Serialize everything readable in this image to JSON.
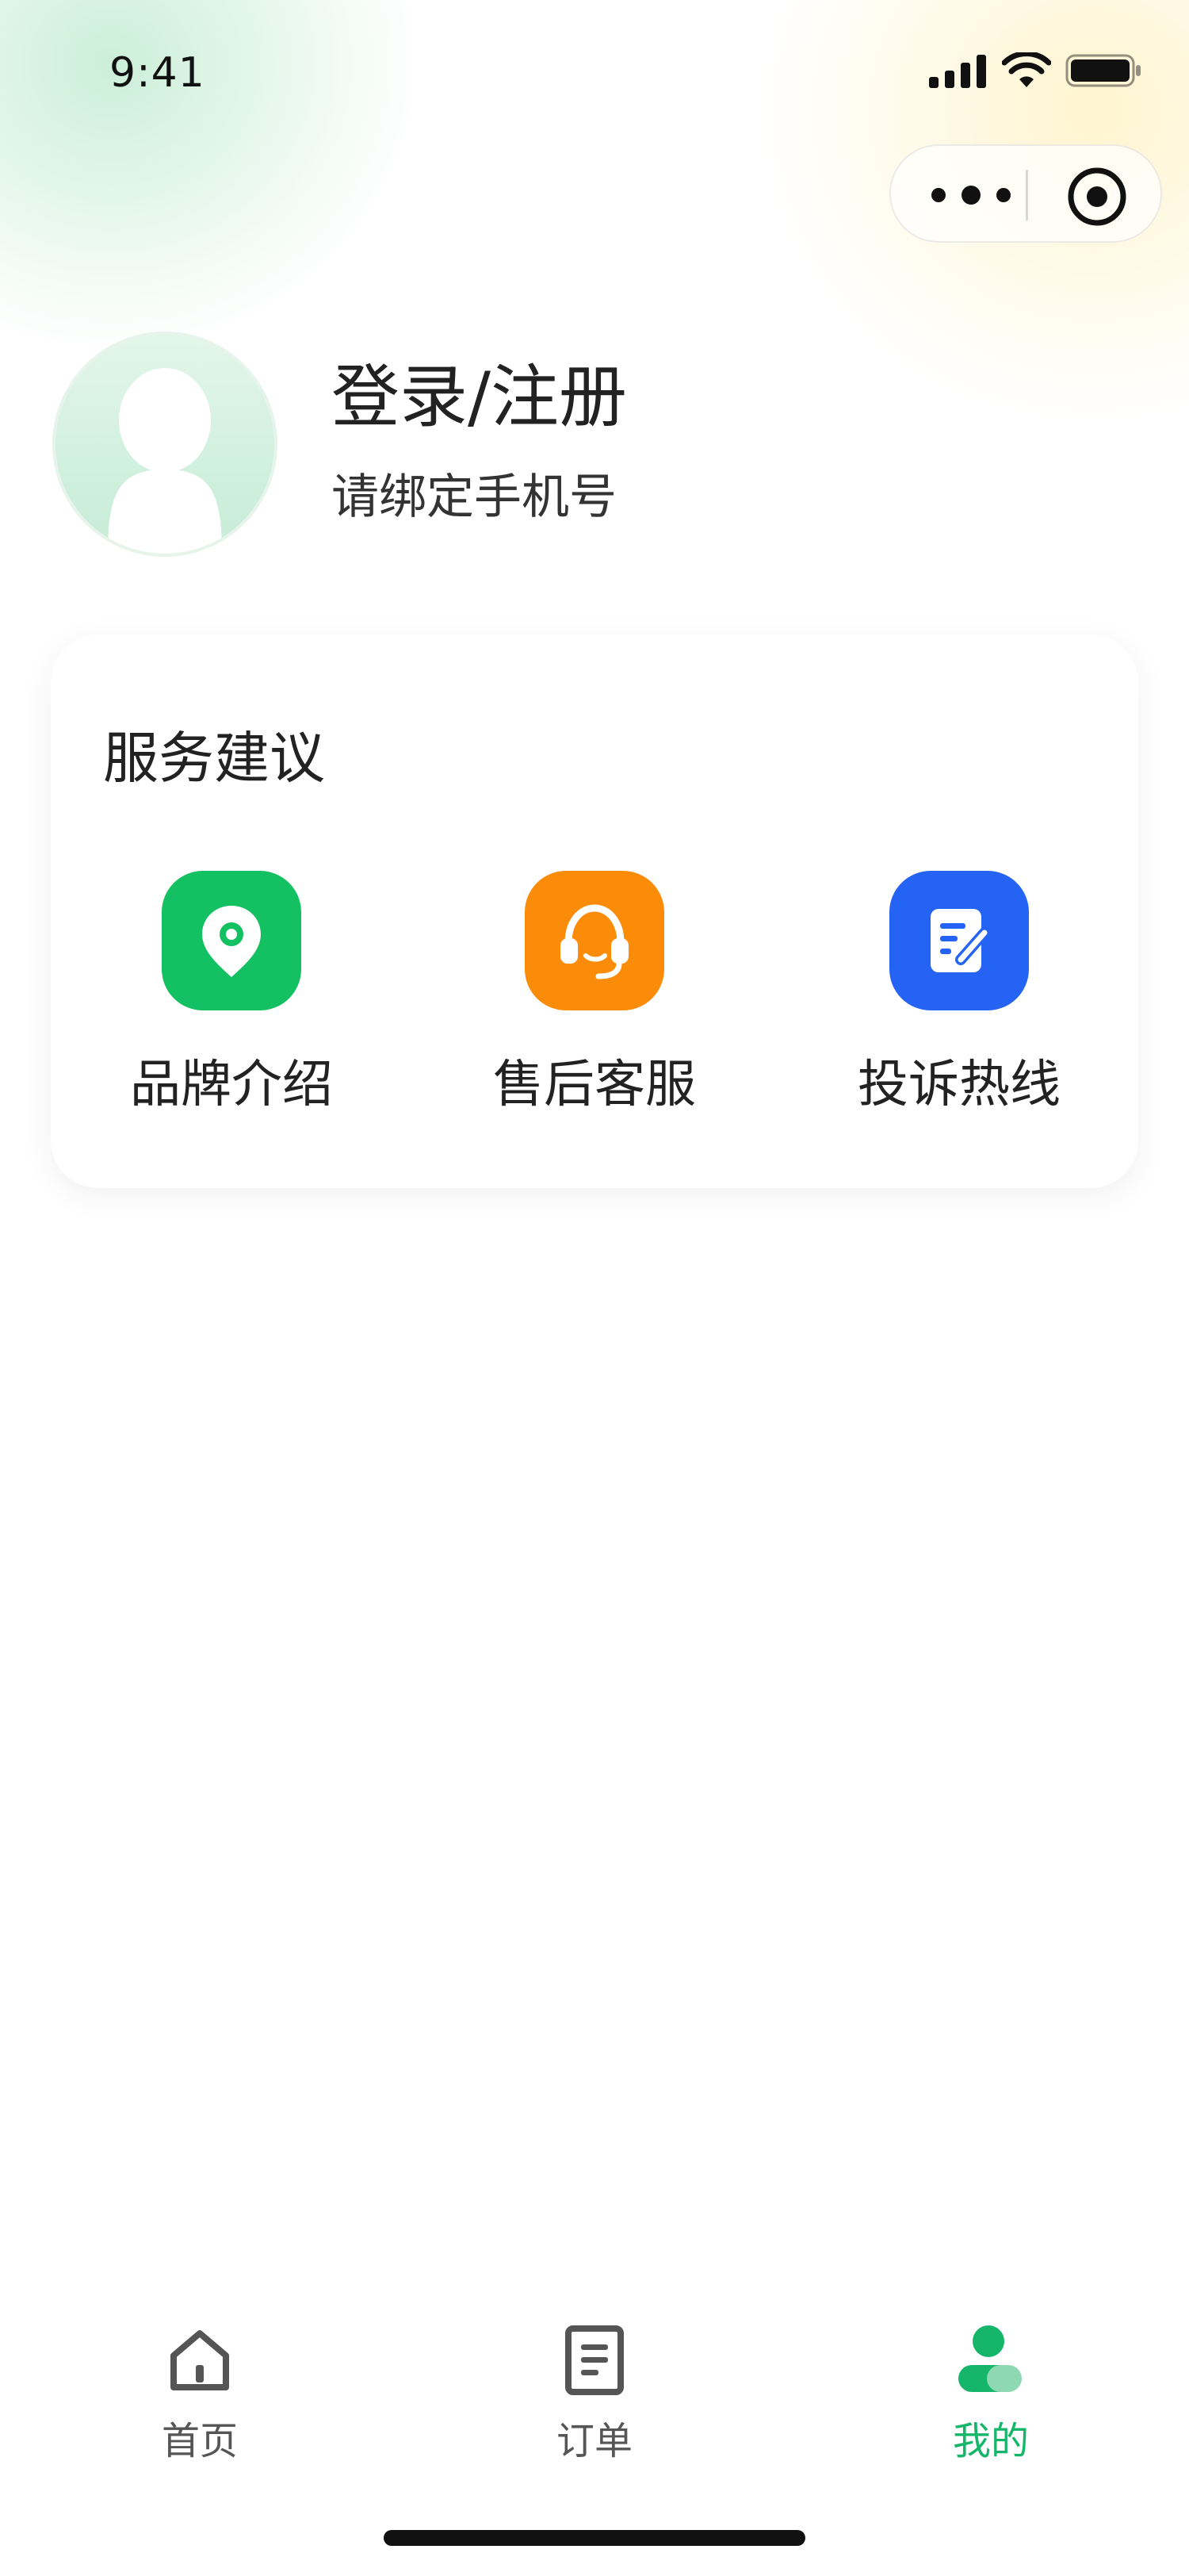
{
  "status_bar": {
    "time": "9:41",
    "icons": [
      "signal-icon",
      "wifi-icon",
      "battery-icon"
    ]
  },
  "capsule": {
    "icons": [
      "more-dots-icon",
      "close-target-icon"
    ]
  },
  "profile": {
    "title": "登录/注册",
    "subtitle": "请绑定手机号",
    "avatar_icon": "person-silhouette-icon"
  },
  "services": {
    "title": "服务建议",
    "items": [
      {
        "label": "品牌介绍",
        "icon": "location-pin-icon",
        "color": "#14c162"
      },
      {
        "label": "售后客服",
        "icon": "headset-icon",
        "color": "#fb8c09"
      },
      {
        "label": "投诉热线",
        "icon": "edit-document-icon",
        "color": "#2563f4"
      }
    ]
  },
  "tabbar": {
    "items": [
      {
        "label": "首页",
        "icon": "home-icon",
        "active": false
      },
      {
        "label": "订单",
        "icon": "order-document-icon",
        "active": false
      },
      {
        "label": "我的",
        "icon": "user-icon",
        "active": true
      }
    ],
    "active_color": "#16b66a",
    "inactive_color": "#555555"
  }
}
